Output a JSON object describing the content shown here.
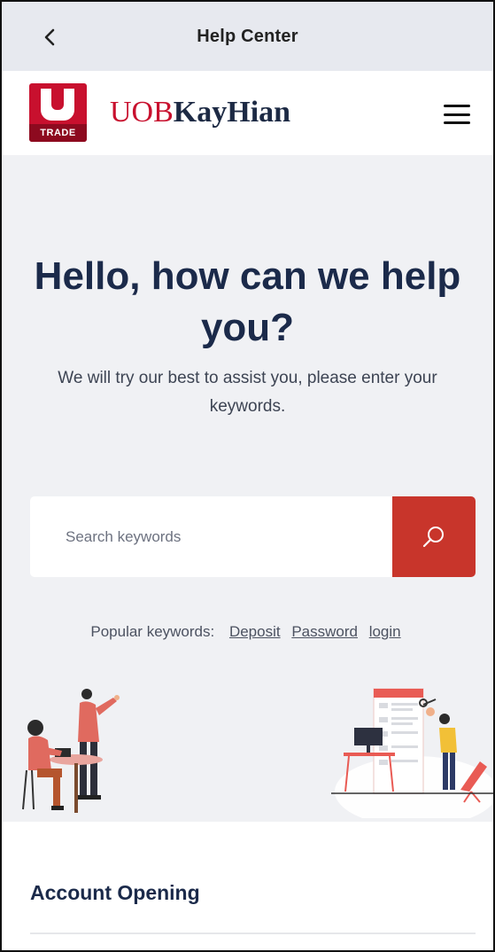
{
  "topbar": {
    "title": "Help Center"
  },
  "brand": {
    "logo_text": "TRADE",
    "name_part1": "UOB",
    "name_part2": "KayHian"
  },
  "hero": {
    "title": "Hello, how can we help you?",
    "subtitle": "We will try our best to assist you, please enter your keywords."
  },
  "search": {
    "placeholder": "Search keywords",
    "value": ""
  },
  "popular": {
    "label": "Popular keywords:",
    "keywords": [
      "Deposit",
      "Password",
      "login"
    ]
  },
  "section": {
    "title": "Account Opening"
  },
  "colors": {
    "brand_red": "#c8102e",
    "search_red": "#c8352b",
    "navy": "#1b2a4a"
  },
  "icons": [
    "chevron-left-icon",
    "hamburger-menu-icon",
    "search-icon"
  ]
}
